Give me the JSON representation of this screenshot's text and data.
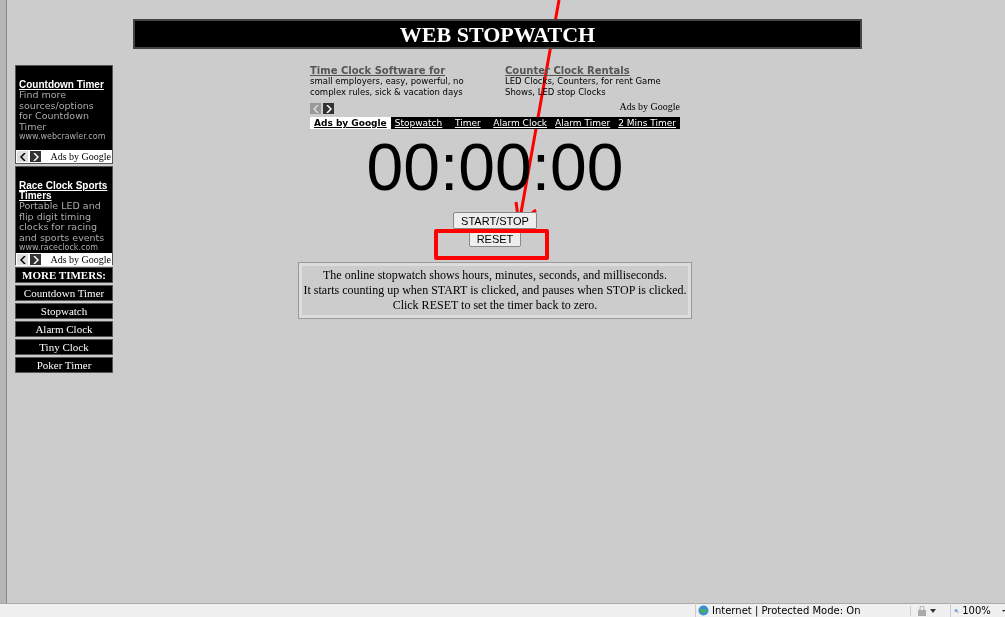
{
  "header": {
    "title": "WEB STOPWATCH"
  },
  "sidebar": {
    "ads": [
      {
        "title": "Countdown Timer",
        "body": "Find more sources/options for Countdown Timer",
        "url": "www.webcrawler.com",
        "ads_label": "Ads by Google"
      },
      {
        "title": "Race Clock Sports Timers",
        "body": "Portable LED and flip digit timing clocks for racing and sports events",
        "url": "www.raceclock.com",
        "ads_label": "Ads by Google"
      }
    ],
    "more_heading": "MORE TIMERS:",
    "links": [
      "Countdown Timer",
      "Stopwatch",
      "Alarm Clock",
      "Tiny Clock",
      "Poker Timer"
    ]
  },
  "top_ads": [
    {
      "title": "Time Clock Software for",
      "body": "small employers, easy, powerful, no complex rules, sick & vacation days"
    },
    {
      "title": "Counter Clock Rentals",
      "body": "LED Clocks, Counters, for rent Game Shows, LED stop Clocks"
    }
  ],
  "top_ads_label": "Ads by Google",
  "nav": [
    {
      "label": "Ads by Google",
      "selected": true
    },
    {
      "label": "Stopwatch",
      "selected": false
    },
    {
      "label": "Timer",
      "selected": false
    },
    {
      "label": "Alarm Clock",
      "selected": false
    },
    {
      "label": "Alarm Timer",
      "selected": false
    },
    {
      "label": "2 Mins Timer",
      "selected": false
    }
  ],
  "display": "00:00:00",
  "buttons": [
    "START/STOP",
    "RESET"
  ],
  "description": [
    "The online stopwatch shows hours, minutes, seconds, and milliseconds.",
    "It starts counting up when START is clicked, and pauses when STOP is clicked.",
    "Click RESET to set the timer back to zero."
  ],
  "status_bar": {
    "zone": "Internet | Protected Mode: On",
    "zoom": "100%"
  }
}
